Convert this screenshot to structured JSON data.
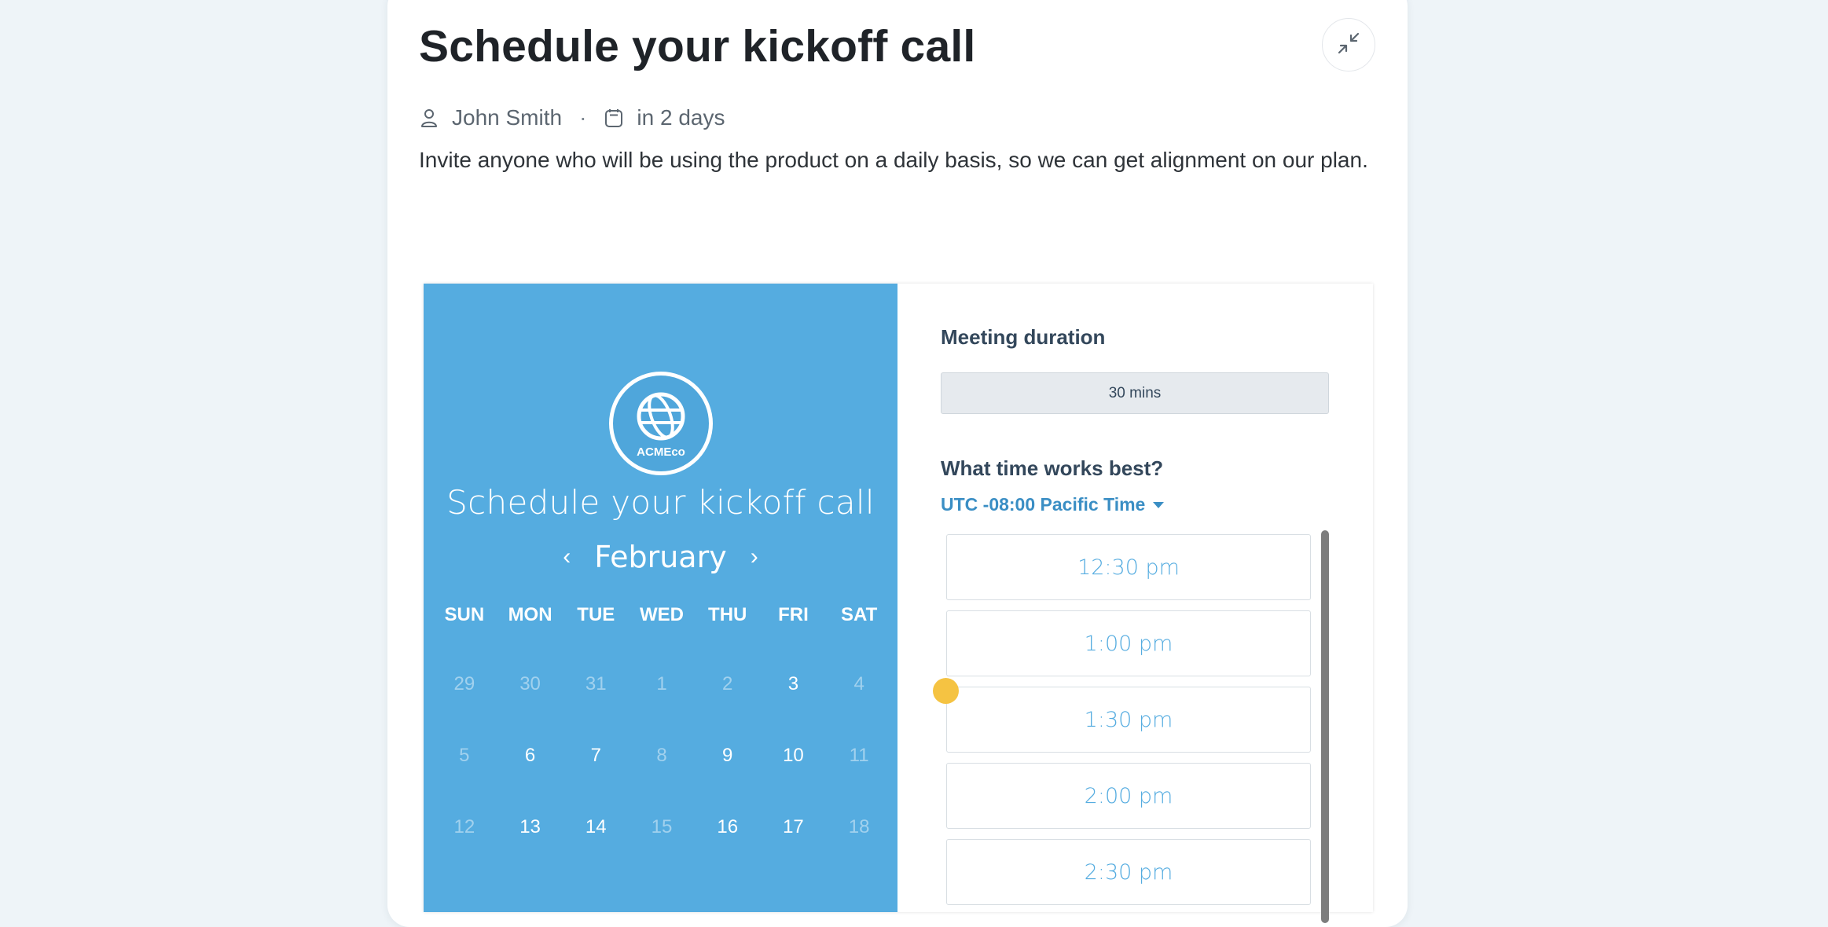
{
  "page": {
    "title": "Schedule your kickoff call",
    "owner": "John Smith",
    "due": "in 2 days",
    "separator": "·",
    "description": "Invite anyone who will be using the product on a daily basis, so we can get alignment on our plan."
  },
  "icons": {
    "collapse": "collapse-icon",
    "user": "user-icon",
    "calendar": "calendar-icon",
    "logo": "globe-logo"
  },
  "widget": {
    "logo_text": "ACMEco",
    "title": "Schedule your kickoff call",
    "month": "February",
    "prev_arrow": "‹",
    "next_arrow": "›",
    "weekdays": [
      "SUN",
      "MON",
      "TUE",
      "WED",
      "THU",
      "FRI",
      "SAT"
    ],
    "days": [
      {
        "label": "29",
        "available": false
      },
      {
        "label": "30",
        "available": false
      },
      {
        "label": "31",
        "available": false
      },
      {
        "label": "1",
        "available": false
      },
      {
        "label": "2",
        "available": false
      },
      {
        "label": "3",
        "available": true
      },
      {
        "label": "4",
        "available": false
      },
      {
        "label": "5",
        "available": false
      },
      {
        "label": "6",
        "available": true
      },
      {
        "label": "7",
        "available": true
      },
      {
        "label": "8",
        "available": false
      },
      {
        "label": "9",
        "available": true
      },
      {
        "label": "10",
        "available": true
      },
      {
        "label": "11",
        "available": false
      },
      {
        "label": "12",
        "available": false
      },
      {
        "label": "13",
        "available": true
      },
      {
        "label": "14",
        "available": true
      },
      {
        "label": "15",
        "available": false
      },
      {
        "label": "16",
        "available": true
      },
      {
        "label": "17",
        "available": true
      },
      {
        "label": "18",
        "available": false
      }
    ],
    "duration_label": "Meeting duration",
    "duration_value": "30 mins",
    "time_label": "What time works best?",
    "timezone": "UTC -08:00 Pacific Time",
    "slots": [
      "12:30 pm",
      "1:00 pm",
      "1:30 pm",
      "2:00 pm",
      "2:30 pm"
    ]
  },
  "colors": {
    "panel_blue": "#55ace0",
    "accent_link": "#3a8ec4",
    "cursor": "#f5c342",
    "background": "#eef4f8"
  }
}
